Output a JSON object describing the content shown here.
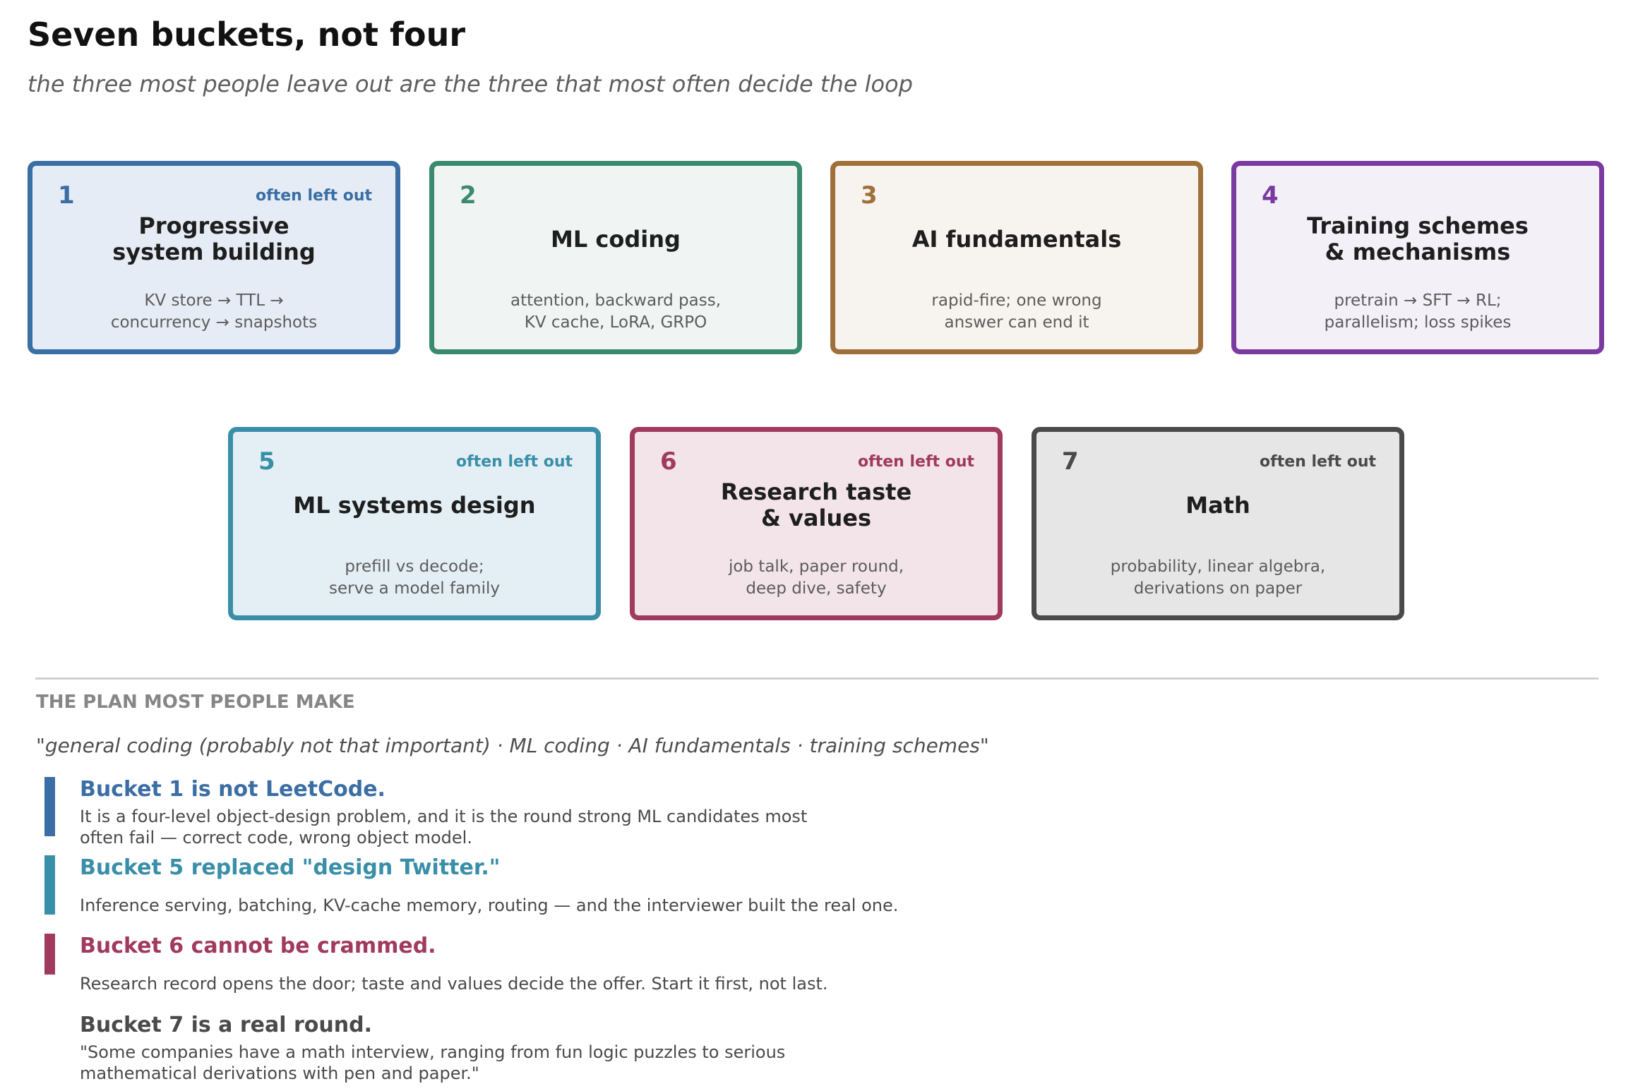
{
  "header": {
    "title": "Seven buckets, not four",
    "subtitle": "the three most people leave out are the three that most often decide the loop"
  },
  "buckets": [
    {
      "number": "1",
      "flag": "often left out",
      "title": "Progressive\nsystem building",
      "description": "KV store → TTL →\nconcurrency → snapshots",
      "accent": "#3a6ea5",
      "fill": "#e6ecf5"
    },
    {
      "number": "2",
      "flag": "",
      "title": "ML coding",
      "description": "attention, backward pass,\nKV cache, LoRA, GRPO",
      "accent": "#3a8a6e",
      "fill": "#f0f4f2"
    },
    {
      "number": "3",
      "flag": "",
      "title": "AI fundamentals",
      "description": "rapid-fire; one wrong\nanswer can end it",
      "accent": "#a0703a",
      "fill": "#f7f4f0"
    },
    {
      "number": "4",
      "flag": "",
      "title": "Training schemes\n& mechanisms",
      "description": "pretrain → SFT → RL;\nparallelism; loss spikes",
      "accent": "#7a3aa0",
      "fill": "#f3f0f8"
    },
    {
      "number": "5",
      "flag": "often left out",
      "title": "ML systems design",
      "description": "prefill vs decode;\nserve a model family",
      "accent": "#3a8fa8",
      "fill": "#e4eff5"
    },
    {
      "number": "6",
      "flag": "often left out",
      "title": "Research taste\n& values",
      "description": "job talk, paper round,\ndeep dive, safety",
      "accent": "#a03a5e",
      "fill": "#f3e4e9"
    },
    {
      "number": "7",
      "flag": "often left out",
      "title": "Math",
      "description": "probability, linear algebra,\nderivations on paper",
      "accent": "#4a4a4a",
      "fill": "#e6e6e6"
    }
  ],
  "plan": {
    "heading": "THE PLAN MOST PEOPLE MAKE",
    "quote": "\"general coding (probably not that important)  ·  ML coding  ·  AI fundamentals  ·  training schemes\""
  },
  "notes": [
    {
      "title": "Bucket 1 is not LeetCode.",
      "body": "It is a four-level object-design problem, and it is the round strong ML candidates most\noften fail — correct code, wrong object model.",
      "color": "#3a6ea5"
    },
    {
      "title": "Bucket 5 replaced \"design Twitter.\"",
      "body": "Inference serving, batching, KV-cache memory, routing — and the interviewer built the real one.",
      "color": "#3a8fa8"
    },
    {
      "title": "Bucket 6 cannot be crammed.",
      "body": "Research record opens the door; taste and values decide the offer. Start it first, not last.",
      "color": "#a03a5e"
    },
    {
      "title": "Bucket 7 is a real round.",
      "body": "\"Some companies have a math interview, ranging from fun logic puzzles to serious\nmathematical derivations with pen and paper.\"",
      "color": "#4a4a4a"
    }
  ]
}
